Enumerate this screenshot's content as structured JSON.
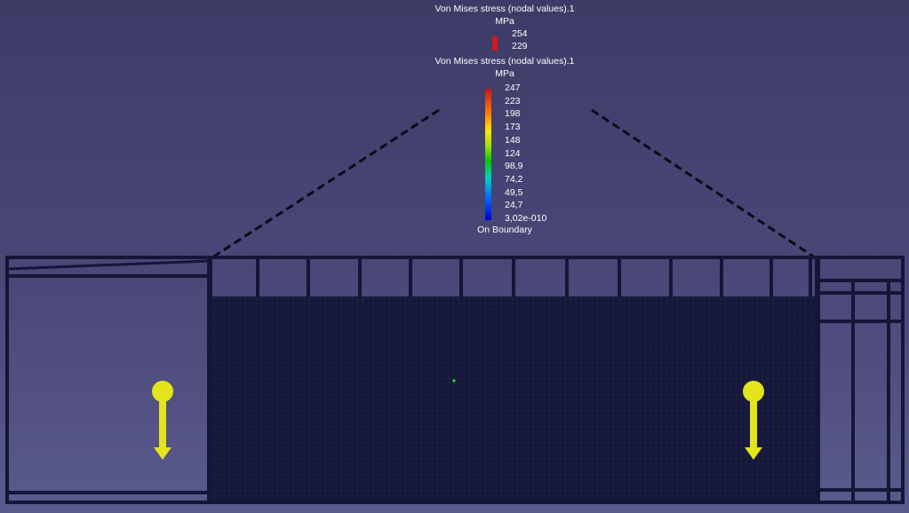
{
  "legend_secondary": {
    "title": "Von Mises stress (nodal values).1",
    "unit": "MPa",
    "values": [
      "254",
      "229"
    ]
  },
  "legend_primary": {
    "title": "Von Mises stress (nodal values).1",
    "unit": "MPa",
    "values": [
      "247",
      "223",
      "198",
      "173",
      "148",
      "124",
      "98,9",
      "74,2",
      "49,5",
      "24,7",
      "3,02e-010"
    ],
    "footer": "On Boundary"
  },
  "colors": {
    "background_top": "#3d3b66",
    "background_bottom": "#5a5a8c",
    "structure": "#141638",
    "load_arrow": "#e4e41c"
  },
  "icons": [
    "load-arrow-icon",
    "load-arrow-icon"
  ]
}
